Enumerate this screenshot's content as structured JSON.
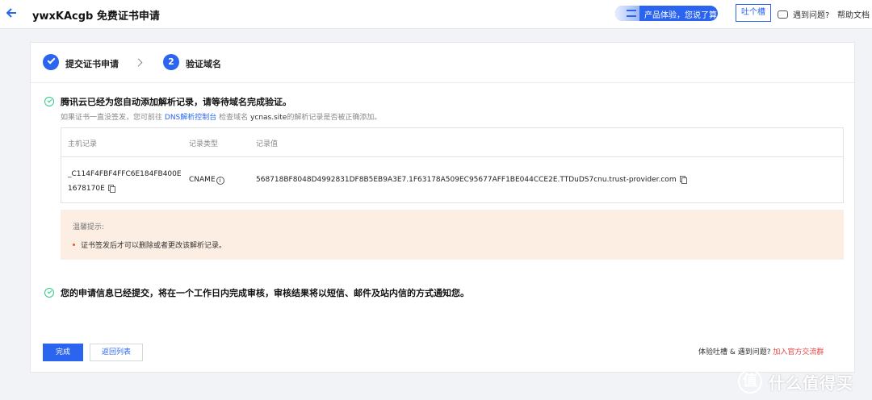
{
  "header": {
    "title": "ywxKAcgb 免费证书申请",
    "promo_label": "产品体验，您说了算",
    "feedback_label": "吐个槽",
    "issue_label": "遇到问题?",
    "docs_label": "帮助文档"
  },
  "steps": [
    {
      "label": "提交证书申请",
      "status": "done"
    },
    {
      "number": "2",
      "label": "验证域名",
      "status": "current"
    }
  ],
  "verify": {
    "message": "腾讯云已经为您自动添加解析记录，请等待域名完成验证。",
    "hint_prefix": "如果证书一直没签发，您可前往",
    "hint_link": "DNS解析控制台",
    "hint_middle": "检查域名",
    "hint_domain": "ycnas.site",
    "hint_suffix": "的解析记录是否被正确添加。"
  },
  "table": {
    "columns": [
      "主机记录",
      "记录类型",
      "记录值"
    ],
    "row": {
      "host_line1": "_C114F4FBF4FFC6E184FB400E",
      "host_line2": "1678170E",
      "type": "CNAME",
      "value": "568718BF8048D4992831DF8B5EB9A3E7.1F63178A509EC95677AFF1BE044CCE2E.TTDuDS7cnu.trust-provider.com"
    }
  },
  "notice": {
    "title": "温馨提示:",
    "items": [
      "证书签发后才可以删除或者更改该解析记录。"
    ]
  },
  "submitted": {
    "message": "您的申请信息已经提交，将在一个工作日内完成审核，审核结果将以短信、邮件及站内信的方式通知您。"
  },
  "footer": {
    "done_label": "完成",
    "back_label": "返回列表",
    "text_prefix": "体验吐槽 & 遇到问题?",
    "text_link": "加入官方交流群"
  },
  "watermark": {
    "logo_char": "值",
    "text": "什么值得买"
  },
  "colors": {
    "primary": "#2b64ef",
    "success": "#29cc85",
    "notice_bg": "#fdeee3",
    "link_red": "#e54545"
  }
}
